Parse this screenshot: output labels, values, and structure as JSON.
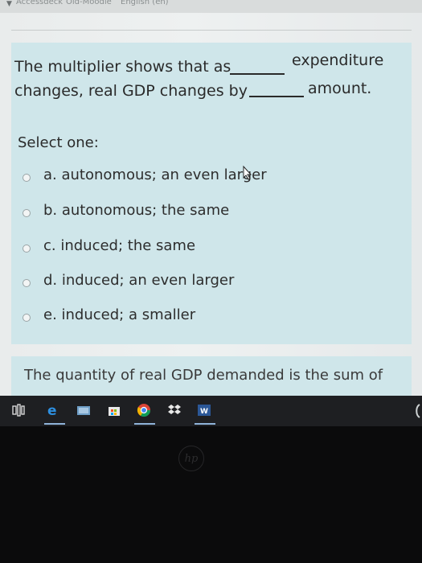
{
  "top_tabs": [
    "Accessdeck",
    "Old-Moodle",
    "English (en)"
  ],
  "question": {
    "line1_start": "The multiplier shows that as",
    "line1_end": "expenditure",
    "line2_start": "changes, real GDP changes by",
    "line2_end": "amount."
  },
  "select_label": "Select one:",
  "options": [
    {
      "label": "a. autonomous; an even larger"
    },
    {
      "label": "b. autonomous; the same"
    },
    {
      "label": "c. induced; the same"
    },
    {
      "label": "d. induced; an even larger"
    },
    {
      "label": "e. induced; a smaller"
    }
  ],
  "next_question": "The quantity of real GDP demanded is the sum of",
  "taskbar_icons": [
    "task-view-icon",
    "edge-icon",
    "photos-icon",
    "store-icon",
    "chrome-icon",
    "dropbox-icon",
    "word-icon"
  ],
  "bezel_logo": "hp",
  "colors": {
    "card": "#cfe6ea",
    "page": "#eceeee",
    "text": "#2a2a2a",
    "taskbar": "#1e1f22"
  }
}
